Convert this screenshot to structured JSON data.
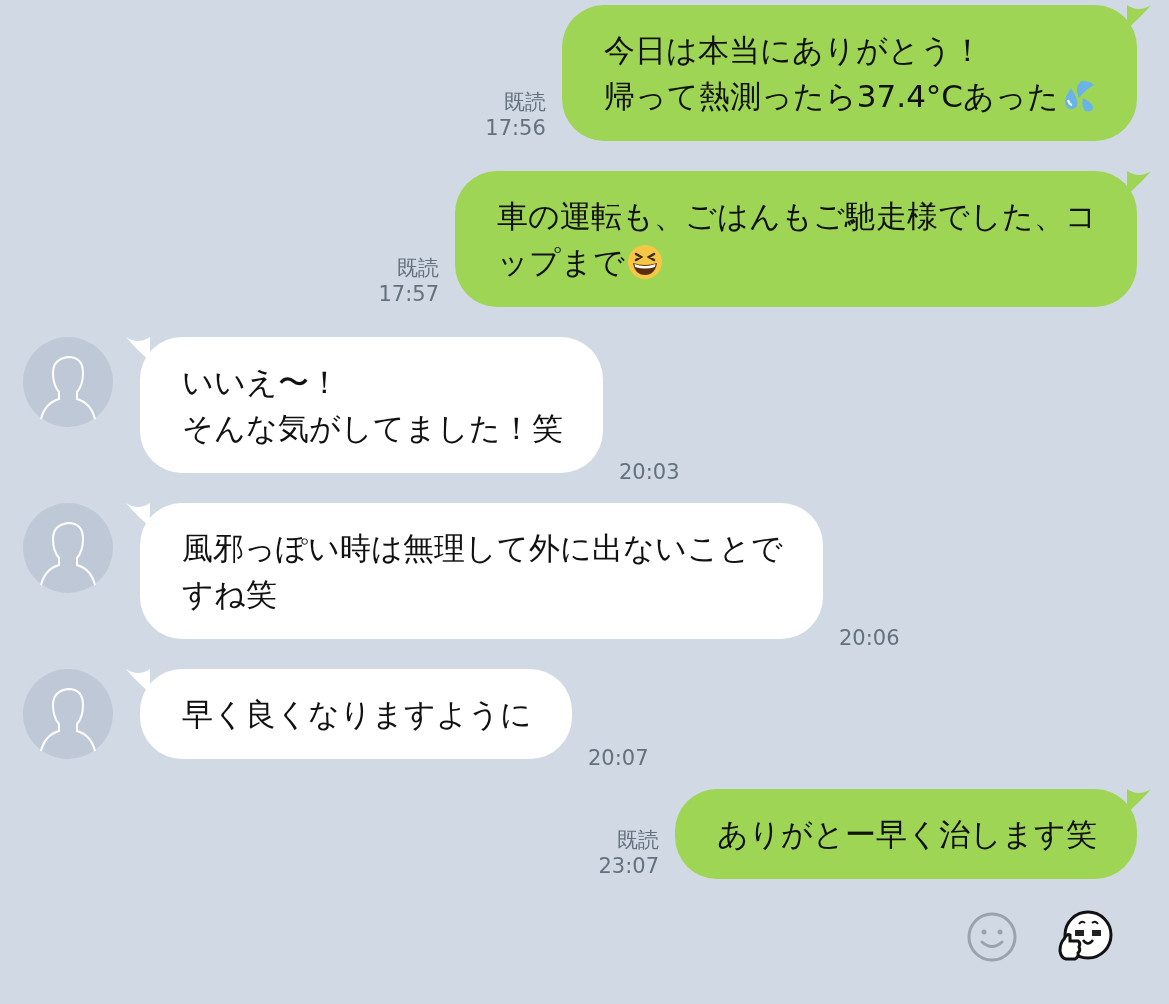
{
  "messages": [
    {
      "kind": "sent",
      "read": "既読",
      "time": "17:56",
      "lines": [
        "今日は本当にありがとう！",
        "帰って熱測ったら37.4°Cあった"
      ],
      "emoji": {
        "kind": "sweat"
      }
    },
    {
      "kind": "sent",
      "read": "既読",
      "time": "17:57",
      "lines": [
        "車の運転も、ごはんもご馳走様でした、コ",
        "ップまで"
      ],
      "emoji": {
        "kind": "laugh"
      }
    },
    {
      "kind": "received",
      "time": "20:03",
      "lines": [
        "いいえ〜！",
        "そんな気がしてました！笑"
      ]
    },
    {
      "kind": "received",
      "time": "20:06",
      "lines": [
        "風邪っぽい時は無理して外に出ないことで",
        "すね笑"
      ]
    },
    {
      "kind": "received",
      "time": "20:07",
      "lines": [
        "早く良くなりますように"
      ]
    },
    {
      "kind": "sent",
      "read": "既読",
      "time": "23:07",
      "lines": [
        "ありがとー早く治します笑"
      ]
    }
  ]
}
